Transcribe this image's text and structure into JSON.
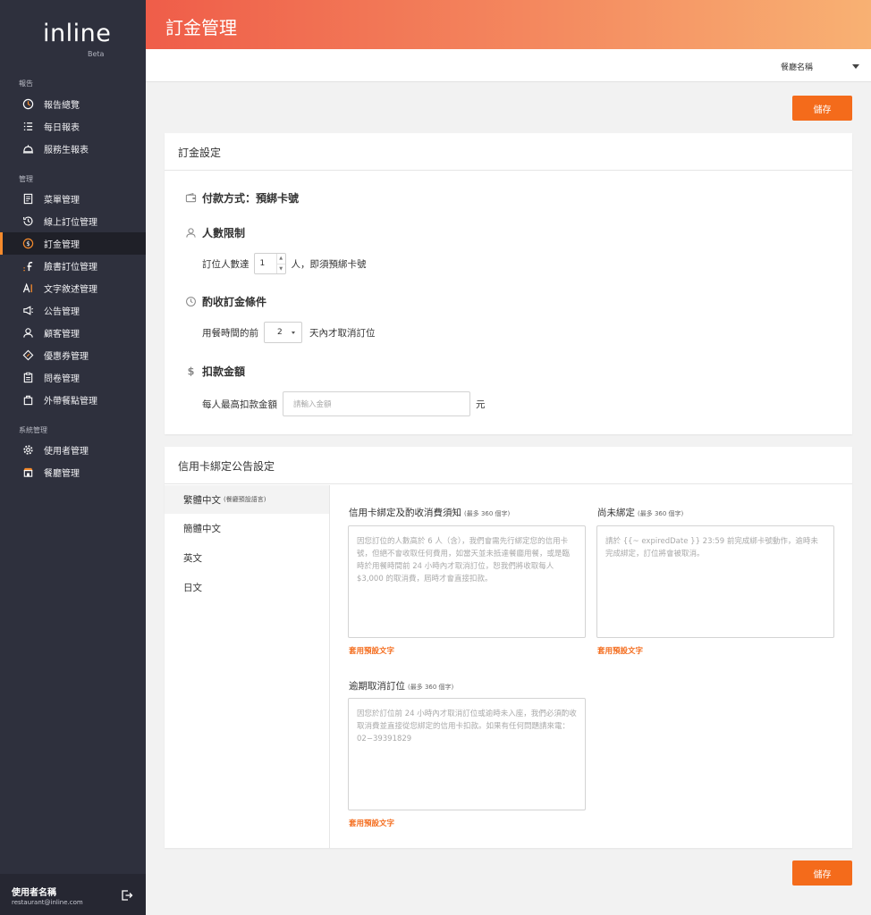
{
  "brand": {
    "logo": "inline",
    "beta": "Beta"
  },
  "sidebar": {
    "sections": [
      {
        "label": "報告",
        "items": [
          {
            "label": "報告總覽",
            "icon": "report-overview-icon"
          },
          {
            "label": "每日報表",
            "icon": "list-icon"
          },
          {
            "label": "服務生報表",
            "icon": "service-bell-icon"
          }
        ]
      },
      {
        "label": "管理",
        "items": [
          {
            "label": "菜單管理",
            "icon": "menu-book-icon"
          },
          {
            "label": "線上訂位管理",
            "icon": "history-clock-icon"
          },
          {
            "label": "訂金管理",
            "icon": "dollar-circle-icon",
            "active": true
          },
          {
            "label": "臉書訂位管理",
            "icon": "facebook-icon"
          },
          {
            "label": "文字敘述管理",
            "icon": "text-ai-icon"
          },
          {
            "label": "公告管理",
            "icon": "megaphone-icon"
          },
          {
            "label": "顧客管理",
            "icon": "person-icon"
          },
          {
            "label": "優惠券管理",
            "icon": "coupon-icon"
          },
          {
            "label": "問卷管理",
            "icon": "clipboard-icon"
          },
          {
            "label": "外帶餐點管理",
            "icon": "bag-icon"
          }
        ]
      },
      {
        "label": "系統管理",
        "items": [
          {
            "label": "使用者管理",
            "icon": "gear-icon"
          },
          {
            "label": "餐廳管理",
            "icon": "store-icon"
          }
        ]
      }
    ],
    "user": {
      "name": "使用者名稱",
      "email": "restaurant@inline.com"
    }
  },
  "header": {
    "title": "訂金管理",
    "restaurant_select": "餐廳名稱"
  },
  "actions": {
    "save_label": "儲存"
  },
  "deposit_settings": {
    "title": "訂金設定",
    "payment": {
      "label": "付款方式：預綁卡號"
    },
    "people_limit": {
      "title": "人數限制",
      "prefix": "訂位人數達",
      "value": "1",
      "suffix": "人，即須預綁卡號"
    },
    "charge_condition": {
      "title": "酌收訂金條件",
      "prefix": "用餐時間的前",
      "value": "2",
      "suffix": "天內才取消訂位"
    },
    "charge_amount": {
      "title": "扣款金額",
      "prefix": "每人最高扣款金額",
      "placeholder": "請輸入金額",
      "suffix": "元"
    }
  },
  "card_notice": {
    "title": "信用卡綁定公告設定",
    "languages": [
      {
        "label": "繁體中文",
        "note": "(餐廳預設語言)",
        "active": true
      },
      {
        "label": "簡體中文"
      },
      {
        "label": "英文"
      },
      {
        "label": "日文"
      }
    ],
    "fields": [
      {
        "label": "信用卡綁定及酌收消費須知",
        "limit": "(最多 360 個字)",
        "placeholder": "因您訂位的人數高於 6 人（含），我們會需先行綁定您的信用卡號，但絕不會收取任何費用，如當天並未抵達餐廳用餐，或是臨時於用餐時間前 24 小時內才取消訂位，恕我們將收取每人 $3,000 的取消費，屆時才會直接扣款。",
        "link": "套用預設文字"
      },
      {
        "label": "尚未綁定",
        "limit": "(最多 360 個字)",
        "placeholder": "請於 {{~ expiredDate }} 23:59 前完成綁卡號動作，逾時未完成綁定，訂位將會被取消。",
        "link": "套用預設文字"
      },
      {
        "label": "逾期取消訂位",
        "limit": "(最多 360 個字)",
        "placeholder": "因您於訂位前 24 小時內才取消訂位或逾時未入座，我們必須酌收取消費並直接從您綁定的信用卡扣款。如果有任何問題請來電：02−39391829",
        "link": "套用預設文字"
      }
    ]
  },
  "colors": {
    "accent": "#f46b1b",
    "sidebar_bg": "#2e303d",
    "header_start": "#ef5d49",
    "header_end": "#f8b173"
  }
}
